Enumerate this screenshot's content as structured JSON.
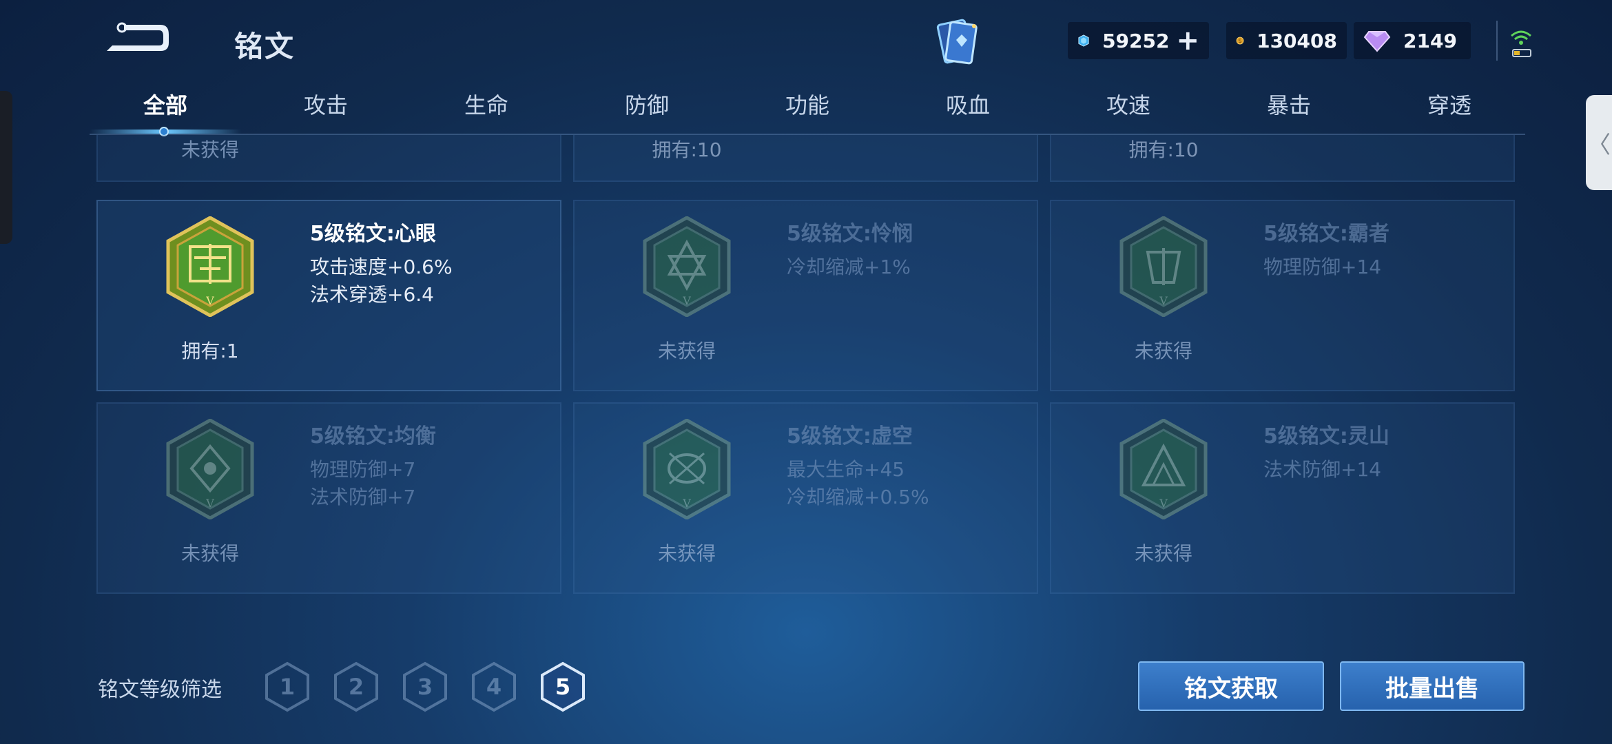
{
  "header": {
    "title": "铭文",
    "currencies": {
      "diamond": "59252",
      "gold": "130408",
      "gem": "2149"
    }
  },
  "tabs": [
    "全部",
    "攻击",
    "生命",
    "防御",
    "功能",
    "吸血",
    "攻速",
    "暴击",
    "穿透"
  ],
  "active_tab": "全部",
  "partial_row": [
    "未获得",
    "拥有:10",
    "拥有:10"
  ],
  "runes": [
    {
      "name": "5级铭文:心眼",
      "stats": [
        "攻击速度+0.6%",
        "法术穿透+6.4"
      ],
      "count": "拥有:1",
      "owned": true
    },
    {
      "name": "5级铭文:怜悯",
      "stats": [
        "冷却缩减+1%"
      ],
      "count": "未获得",
      "owned": false
    },
    {
      "name": "5级铭文:霸者",
      "stats": [
        "物理防御+14"
      ],
      "count": "未获得",
      "owned": false
    },
    {
      "name": "5级铭文:均衡",
      "stats": [
        "物理防御+7",
        "法术防御+7"
      ],
      "count": "未获得",
      "owned": false
    },
    {
      "name": "5级铭文:虚空",
      "stats": [
        "最大生命+45",
        "冷却缩减+0.5%"
      ],
      "count": "未获得",
      "owned": false
    },
    {
      "name": "5级铭文:灵山",
      "stats": [
        "法术防御+14"
      ],
      "count": "未获得",
      "owned": false
    }
  ],
  "filter": {
    "label": "铭文等级筛选",
    "levels": [
      "1",
      "2",
      "3",
      "4",
      "5"
    ],
    "active": "5"
  },
  "buttons": {
    "acquire": "铭文获取",
    "sell": "批量出售"
  },
  "colors": {
    "accent": "#6cc8ff",
    "button": "#2f6fbd",
    "rune_gold": "#c9a33b",
    "rune_green": "#4fa83c"
  }
}
